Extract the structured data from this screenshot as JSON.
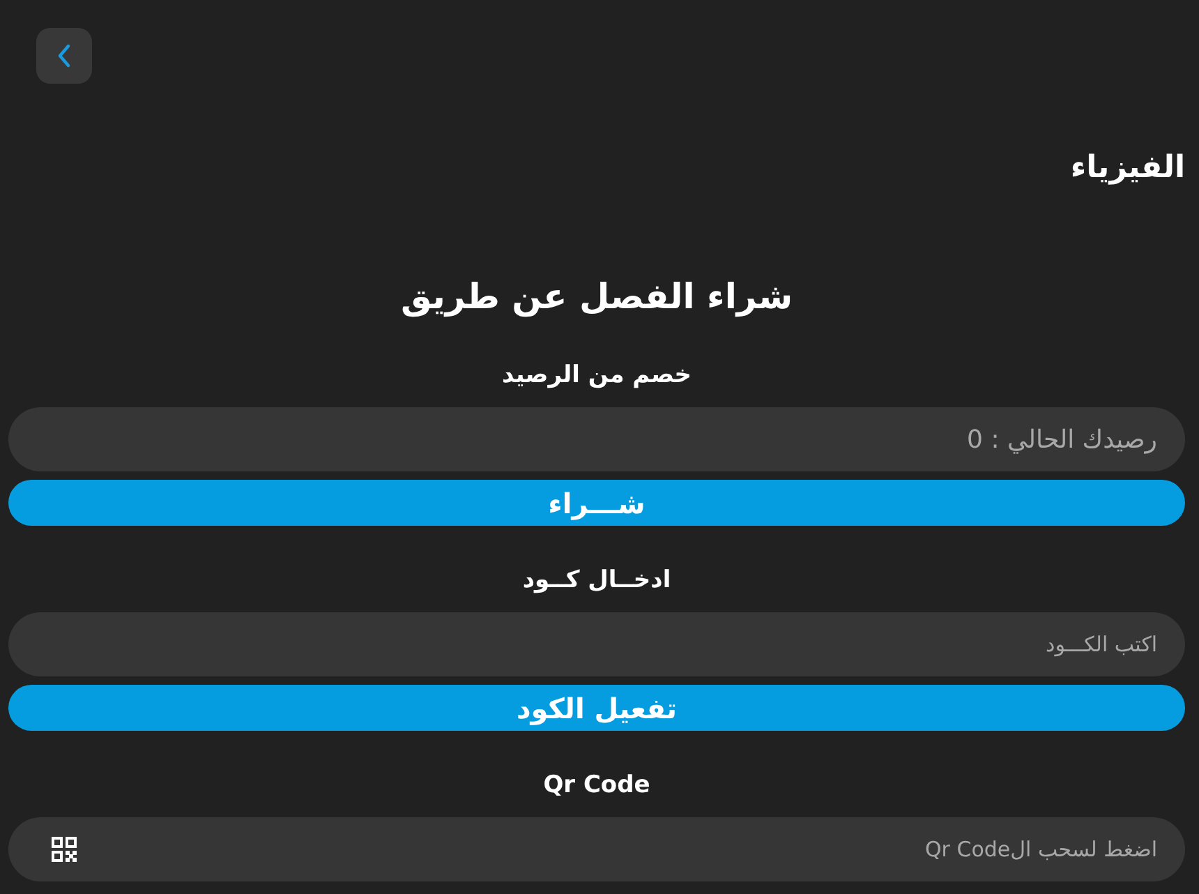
{
  "page_title": "الفيزياء",
  "heading": "شراء الفصل عن طريق",
  "sections": [
    {
      "kind": "balance",
      "label": "خصم من الرصيد",
      "value": "رصيدك الحالي : 0",
      "button": "شـــراء"
    },
    {
      "kind": "code",
      "label": "ادخــال كــود",
      "placeholder": "اكتب الكـــود",
      "button": "تفعيل الكود"
    },
    {
      "kind": "qr",
      "label": "Qr Code",
      "action": "اضغط لسحب الQr Code"
    }
  ]
}
